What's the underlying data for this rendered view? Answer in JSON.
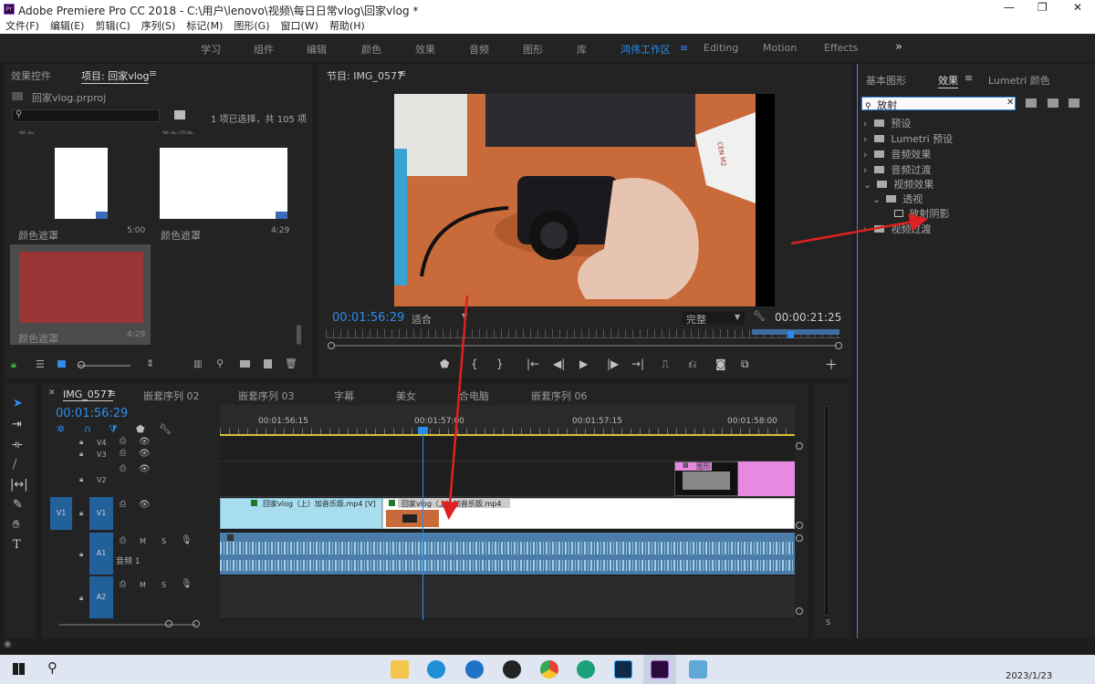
{
  "app": {
    "title": "Adobe Premiere Pro CC 2018 - C:\\用户\\lenovo\\视频\\每日日常vlog\\回家vlog *",
    "logo_text": "Pr"
  },
  "menu": [
    "文件(F)",
    "编辑(E)",
    "剪辑(C)",
    "序列(S)",
    "标记(M)",
    "图形(G)",
    "窗口(W)",
    "帮助(H)"
  ],
  "workspaces": [
    "学习",
    "组件",
    "编辑",
    "颜色",
    "效果",
    "音频",
    "图形",
    "库",
    "鸿伟工作区",
    "Editing",
    "Motion",
    "Effects"
  ],
  "active_workspace": "鸿伟工作区",
  "project_panel": {
    "tabs": [
      "效果控件",
      "项目: 回家vlog"
    ],
    "file": "回家vlog.prproj",
    "status": "1 项已选择，共 105 项",
    "top_labels": [
      "美女",
      "美女调色"
    ],
    "items": [
      {
        "name": "颜色遮罩",
        "duration": "5:00",
        "thumb": "#ffffff"
      },
      {
        "name": "颜色遮罩",
        "duration": "4:29",
        "thumb": "#ffffff"
      },
      {
        "name": "颜色遮罩",
        "duration": "4:29",
        "thumb": "#9a3536"
      }
    ]
  },
  "program_monitor": {
    "title": "节目: IMG_0577",
    "timecode": "00:01:56:29",
    "fit": "适合",
    "quality": "完整",
    "duration": "00:00:21:25",
    "icon_sticker": "CEN M2"
  },
  "effects_panel": {
    "tabs": [
      "基本图形",
      "效果",
      "Lumetri 颜色"
    ],
    "search_value": "放射",
    "tree": [
      {
        "label": "预设",
        "level": 0,
        "expanded": false
      },
      {
        "label": "Lumetri 预设",
        "level": 0,
        "expanded": false
      },
      {
        "label": "音频效果",
        "level": 0,
        "expanded": false
      },
      {
        "label": "音频过渡",
        "level": 0,
        "expanded": false
      },
      {
        "label": "视频效果",
        "level": 0,
        "expanded": true
      },
      {
        "label": "透视",
        "level": 1,
        "expanded": true
      },
      {
        "label": "放射阴影",
        "level": 2,
        "expanded": false
      },
      {
        "label": "视频过渡",
        "level": 0,
        "expanded": false
      }
    ]
  },
  "timeline": {
    "tabs": [
      "IMG_0577",
      "嵌套序列 02",
      "嵌套序列 03",
      "字幕",
      "美女",
      "合电脑",
      "嵌套序列 06"
    ],
    "timecode": "00:01:56:29",
    "ruler": [
      "00:01:56:15",
      "00:01:57:00",
      "00:01:57:15",
      "00:01:58:00"
    ],
    "tracks": [
      {
        "id": "V4",
        "label": ""
      },
      {
        "id": "V3",
        "label": ""
      },
      {
        "id": "V2",
        "label": ""
      },
      {
        "id": "V1",
        "label": "V1"
      },
      {
        "id": "A1",
        "label": "音频 1"
      },
      {
        "id": "A2",
        "label": ""
      }
    ],
    "clips": {
      "v1_a": "回家vlog（上）加音乐版.mp4 [V]",
      "v1_b": "回家vlog（上）加音乐版.mp4",
      "v2_title": "图形"
    },
    "track_letters": {
      "mute": "M",
      "solo": "S"
    }
  },
  "taskbar": {
    "clock": "2023/1/23"
  },
  "colors": {
    "accent": "#2d8ceb",
    "video_clip": "#a8dcef",
    "graphic_clip": "#e58ae0",
    "audio_clip": "#4b7da8",
    "arrow": "#e02020"
  }
}
